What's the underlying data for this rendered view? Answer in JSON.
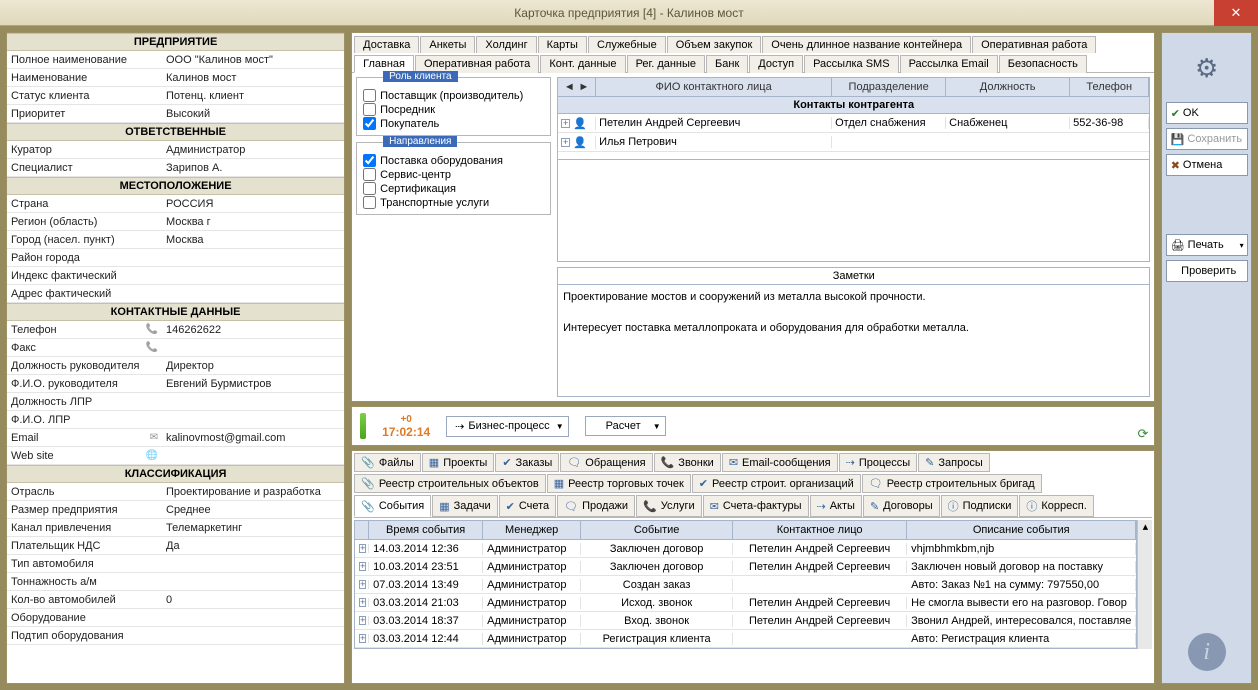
{
  "window": {
    "title": "Карточка предприятия [4] - Калинов мост"
  },
  "sidebar": {
    "groups": [
      {
        "title": "ПРЕДПРИЯТИЕ",
        "rows": [
          {
            "label": "Полное наименование",
            "value": "ООО \"Калинов мост\""
          },
          {
            "label": "Наименование",
            "value": "Калинов мост"
          },
          {
            "label": "Статус клиента",
            "value": "Потенц. клиент"
          },
          {
            "label": "Приоритет",
            "value": "Высокий"
          }
        ]
      },
      {
        "title": "ОТВЕТСТВЕННЫЕ",
        "rows": [
          {
            "label": "Куратор",
            "value": "Администратор"
          },
          {
            "label": "Специалист",
            "value": "Зарипов А."
          }
        ]
      },
      {
        "title": "МЕСТОПОЛОЖЕНИЕ",
        "rows": [
          {
            "label": "Страна",
            "value": "РОССИЯ"
          },
          {
            "label": "Регион (область)",
            "value": "Москва г"
          },
          {
            "label": "Город (насел. пункт)",
            "value": "Москва"
          },
          {
            "label": "Район города",
            "value": ""
          },
          {
            "label": "Индекс фактический",
            "value": ""
          },
          {
            "label": "Адрес фактический",
            "value": ""
          }
        ]
      },
      {
        "title": "КОНТАКТНЫЕ ДАННЫЕ",
        "rows": [
          {
            "label": "Телефон",
            "value": "146262622",
            "icon": "phone"
          },
          {
            "label": "Факс",
            "value": "",
            "icon": "phone"
          },
          {
            "label": "Должность руководителя",
            "value": "Директор"
          },
          {
            "label": "Ф.И.О. руководителя",
            "value": "Евгений Бурмистров"
          },
          {
            "label": "Должность ЛПР",
            "value": ""
          },
          {
            "label": "Ф.И.О. ЛПР",
            "value": ""
          },
          {
            "label": "Email",
            "value": "kalinovmost@gmail.com",
            "icon": "mail"
          },
          {
            "label": "Web site",
            "value": "",
            "icon": "globe"
          }
        ]
      },
      {
        "title": "КЛАССИФИКАЦИЯ",
        "rows": [
          {
            "label": "Отрасль",
            "value": "Проектирование и разработка"
          },
          {
            "label": "Размер предприятия",
            "value": "Среднее"
          },
          {
            "label": "Канал привлечения",
            "value": "Телемаркетинг"
          },
          {
            "label": "Плательщик НДС",
            "value": "Да"
          },
          {
            "label": "Тип автомобиля",
            "value": ""
          },
          {
            "label": "Тоннажность а/м",
            "value": ""
          },
          {
            "label": "Кол-во автомобилей",
            "value": "0"
          },
          {
            "label": "Оборудование",
            "value": ""
          },
          {
            "label": "Подтип оборудования",
            "value": ""
          }
        ]
      }
    ]
  },
  "topTabs1": [
    "Доставка",
    "Анкеты",
    "Холдинг",
    "Карты",
    "Служебные",
    "Объем закупок",
    "Очень длинное название контейнера",
    "Оперативная работа"
  ],
  "topTabs2": [
    "Главная",
    "Оперативная работа",
    "Конт. данные",
    "Рег. данные",
    "Банк",
    "Доступ",
    "Рассылка SMS",
    "Рассылка Email",
    "Безопасность"
  ],
  "topTabs2Active": 0,
  "clientRole": {
    "legend": "Роль клиента",
    "items": [
      {
        "label": "Поставщик (производитель)",
        "checked": false
      },
      {
        "label": "Посредник",
        "checked": false
      },
      {
        "label": "Покупатель",
        "checked": true
      }
    ]
  },
  "directions": {
    "legend": "Направления",
    "items": [
      {
        "label": "Поставка оборудования",
        "checked": true
      },
      {
        "label": "Сервис-центр",
        "checked": false
      },
      {
        "label": "Сертификация",
        "checked": false
      },
      {
        "label": "Транспортные услуги",
        "checked": false
      }
    ]
  },
  "contactCols": [
    "ФИО контактного лица",
    "Подразделение",
    "Должность",
    "Телефон"
  ],
  "contactsTitle": "Контакты контрагента",
  "contacts": [
    {
      "fio": "Петелин Андрей Сергеевич",
      "dep": "Отдел снабжения",
      "pos": "Снабженец",
      "tel": "552-36-98"
    },
    {
      "fio": "Илья Петрович",
      "dep": "",
      "pos": "",
      "tel": ""
    }
  ],
  "notesLabel": "Заметки",
  "notes": "Проектирование мостов и сооружений из металла высокой прочности.\n\nИнтересует поставка металлопроката и оборудования для обработки металла.",
  "processBar": {
    "time": "17:02:14",
    "plus": "+0",
    "btn1": "Бизнес-процесс",
    "btn2": "Расчет"
  },
  "iconTabsRow1": [
    "Файлы",
    "Проекты",
    "Заказы",
    "Обращения",
    "Звонки",
    "Email-сообщения",
    "Процессы",
    "Запросы"
  ],
  "iconTabsRow2": [
    "Реестр строительных объектов",
    "Реестр торговых точек",
    "Реестр строит. организаций",
    "Реестр строительных бригад"
  ],
  "iconTabsRow3": [
    "События",
    "Задачи",
    "Счета",
    "Продажи",
    "Услуги",
    "Счета-фактуры",
    "Акты",
    "Договоры",
    "Подписки",
    "Корресп."
  ],
  "iconTabsRow3Active": 0,
  "eventCols": [
    "Время события",
    "Менеджер",
    "Событие",
    "Контактное лицо",
    "Описание события"
  ],
  "events": [
    {
      "time": "14.03.2014 12:36",
      "mgr": "Администратор",
      "evt": "Заключен договор",
      "contact": "Петелин Андрей Сергеевич",
      "desc": "vhjmbhmkbm,njb"
    },
    {
      "time": "10.03.2014 23:51",
      "mgr": "Администратор",
      "evt": "Заключен договор",
      "contact": "Петелин Андрей Сергеевич",
      "desc": "Заключен новый договор на поставку"
    },
    {
      "time": "07.03.2014 13:49",
      "mgr": "Администратор",
      "evt": "Создан заказ",
      "contact": "",
      "desc": "Авто: Заказ №1 на сумму: 797550,00"
    },
    {
      "time": "03.03.2014 21:03",
      "mgr": "Администратор",
      "evt": "Исход. звонок",
      "contact": "Петелин Андрей Сергеевич",
      "desc": "Не смогла вывести его на разговор. Говор"
    },
    {
      "time": "03.03.2014 18:37",
      "mgr": "Администратор",
      "evt": "Вход. звонок",
      "contact": "Петелин Андрей Сергеевич",
      "desc": "Звонил Андрей, интересовался, поставляе"
    },
    {
      "time": "03.03.2014 12:44",
      "mgr": "Администратор",
      "evt": "Регистрация клиента",
      "contact": "",
      "desc": "Авто: Регистрация клиента"
    }
  ],
  "rightButtons": {
    "ok": "OK",
    "save": "Сохранить",
    "cancel": "Отмена",
    "print": "Печать",
    "check": "Проверить"
  }
}
